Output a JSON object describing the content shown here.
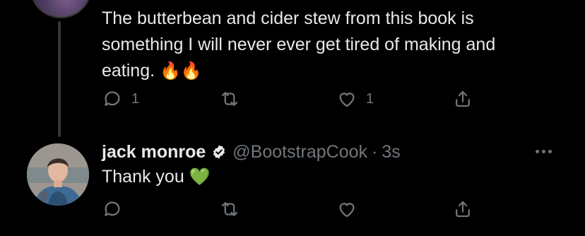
{
  "parent_tweet": {
    "text": "The butterbean and cider stew from this book is\nsomething I will never ever get tired of making and\neating.",
    "emojis": "🔥🔥",
    "reply_count": "1",
    "like_count": "1"
  },
  "reply_tweet": {
    "display_name": "jack monroe",
    "handle": "@BootstrapCook",
    "separator": "·",
    "time": "3s",
    "text": "Thank you",
    "emoji": "💚"
  },
  "icons": {
    "reply": "reply-icon",
    "retweet": "retweet-icon",
    "like": "like-icon",
    "share": "share-icon",
    "verified": "verified-badge-icon",
    "more": "more-options-icon"
  },
  "colors": {
    "background": "#000000",
    "text": "#e7e9ea",
    "muted": "#71767b",
    "thread_line": "#333639"
  }
}
